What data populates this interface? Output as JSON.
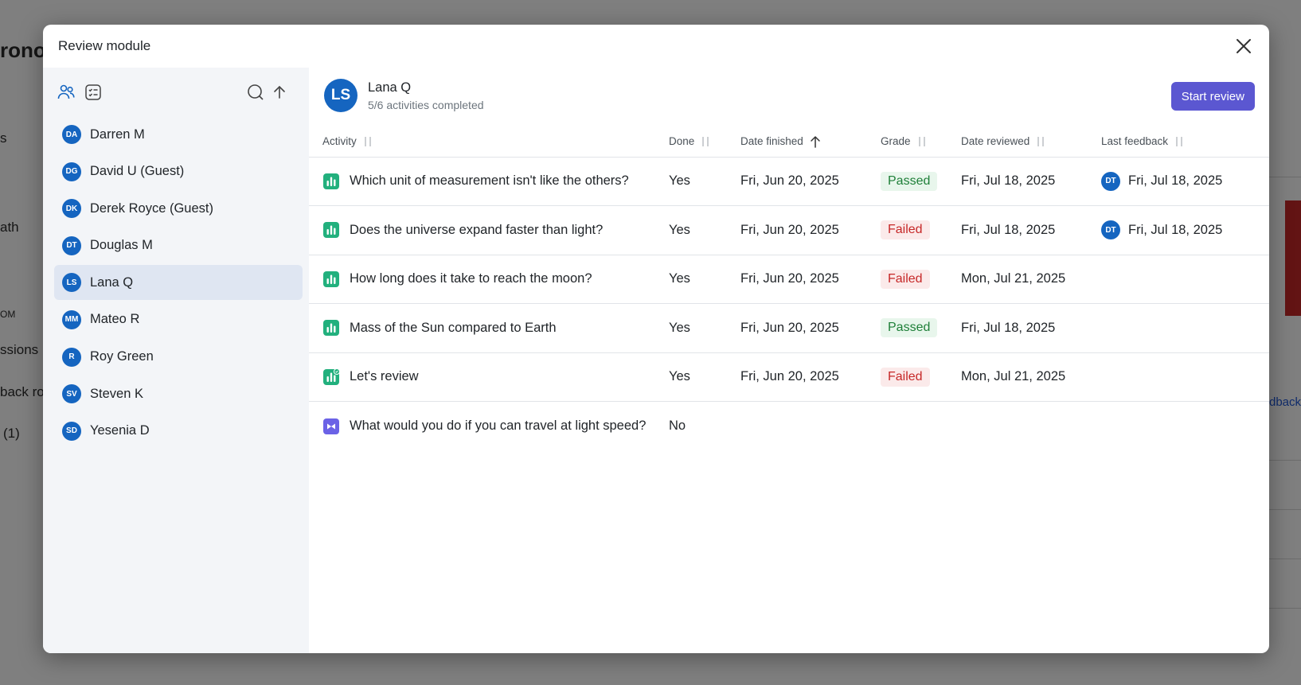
{
  "background": {
    "title_fragment": "ronoı",
    "fragments": [
      "s",
      "ath",
      "OM",
      "ssions",
      "back ro",
      "(1)",
      "dback"
    ]
  },
  "modal": {
    "title": "Review module",
    "close_icon": "close-icon"
  },
  "sidebar": {
    "toolbar": {
      "learners_icon": "users-icon",
      "activities_icon": "checklist-icon",
      "search_icon": "search-icon",
      "sort_icon": "arrow-up-icon"
    },
    "learners": [
      {
        "initials": "DA",
        "name": "Darren M"
      },
      {
        "initials": "DG",
        "name": "David U (Guest)"
      },
      {
        "initials": "DK",
        "name": "Derek Royce (Guest)"
      },
      {
        "initials": "DT",
        "name": "Douglas M"
      },
      {
        "initials": "LS",
        "name": "Lana Q",
        "selected": true
      },
      {
        "initials": "MM",
        "name": "Mateo R"
      },
      {
        "initials": "R",
        "name": "Roy Green"
      },
      {
        "initials": "SV",
        "name": "Steven K"
      },
      {
        "initials": "SD",
        "name": "Yesenia D"
      }
    ]
  },
  "learner_header": {
    "initials": "LS",
    "name": "Lana Q",
    "progress": "5/6 activities completed",
    "start_review_label": "Start review"
  },
  "table": {
    "columns": [
      "Activity",
      "Done",
      "Date finished",
      "Grade",
      "Date reviewed",
      "Last feedback"
    ],
    "rows": [
      {
        "icon": "poll-icon",
        "activity": "Which unit of measurement isn't like the others?",
        "done": "Yes",
        "date_finished": "Fri, Jun 20, 2025",
        "grade": "Passed",
        "date_reviewed": "Fri, Jul 18, 2025",
        "feedback_initials": "DT",
        "last_feedback": "Fri, Jul 18, 2025"
      },
      {
        "icon": "poll-icon",
        "activity": "Does the universe expand faster than light?",
        "done": "Yes",
        "date_finished": "Fri, Jun 20, 2025",
        "grade": "Failed",
        "date_reviewed": "Fri, Jul 18, 2025",
        "feedback_initials": "DT",
        "last_feedback": "Fri, Jul 18, 2025"
      },
      {
        "icon": "poll-icon",
        "activity": "How long does it take to reach the moon?",
        "done": "Yes",
        "date_finished": "Fri, Jun 20, 2025",
        "grade": "Failed",
        "date_reviewed": "Mon, Jul 21, 2025",
        "feedback_initials": "",
        "last_feedback": ""
      },
      {
        "icon": "poll-icon",
        "activity": "Mass of the Sun compared to Earth",
        "done": "Yes",
        "date_finished": "Fri, Jun 20, 2025",
        "grade": "Passed",
        "date_reviewed": "Fri, Jul 18, 2025",
        "feedback_initials": "",
        "last_feedback": ""
      },
      {
        "icon": "poll-review-icon",
        "activity": "Let's review",
        "done": "Yes",
        "date_finished": "Fri, Jun 20, 2025",
        "grade": "Failed",
        "date_reviewed": "Mon, Jul 21, 2025",
        "feedback_initials": "",
        "last_feedback": ""
      },
      {
        "icon": "video-icon",
        "activity": "What would you do if you can travel at light speed?",
        "done": "No",
        "date_finished": "",
        "grade": "",
        "date_reviewed": "",
        "feedback_initials": "",
        "last_feedback": ""
      }
    ]
  },
  "colors": {
    "accent": "#5b57d1",
    "avatar": "#1565c0",
    "passed_bg": "#e8f6ec",
    "passed_text": "#1e7f38",
    "failed_bg": "#fbeaea",
    "failed_text": "#c62828",
    "poll_icon": "#22b07d",
    "video_icon": "#6b62e6"
  }
}
